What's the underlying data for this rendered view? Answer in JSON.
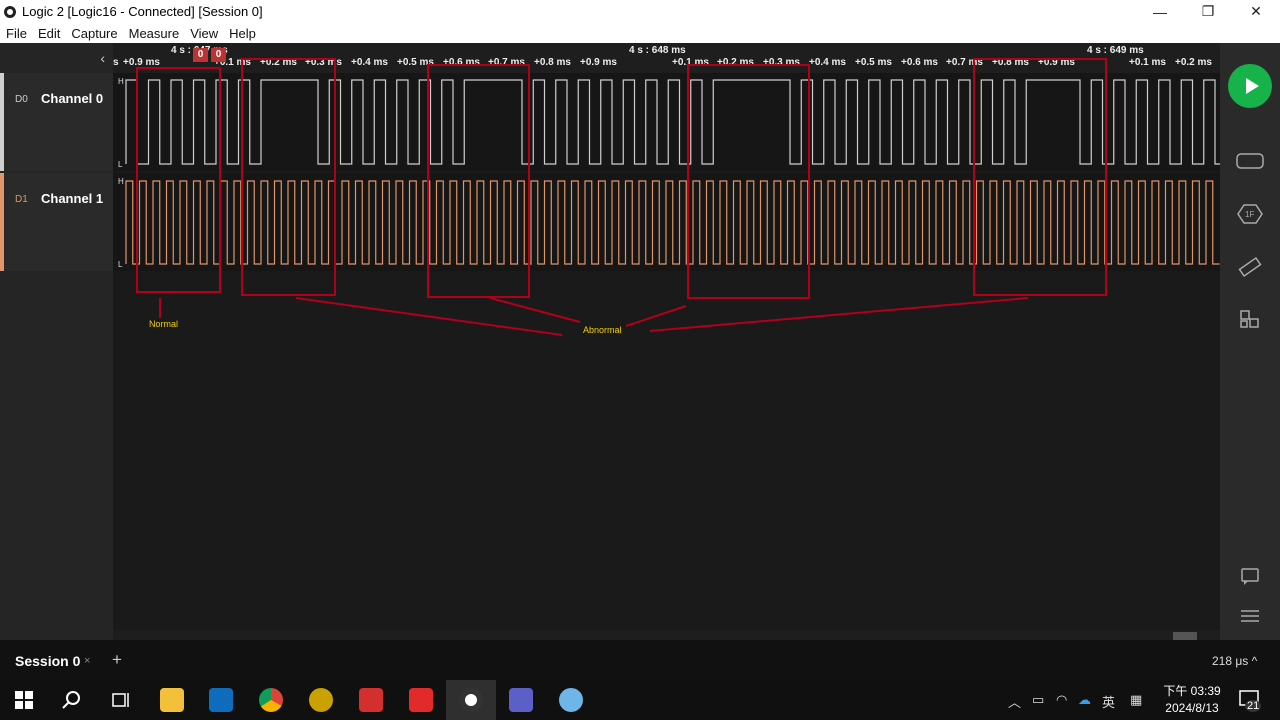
{
  "window": {
    "title": "Logic 2 [Logic16 - Connected] [Session 0]",
    "minimize": "—",
    "maximize": "❐",
    "close": "✕"
  },
  "menu": [
    "File",
    "Edit",
    "Capture",
    "Measure",
    "View",
    "Help"
  ],
  "left_panel": {
    "collapse": "‹",
    "channels": [
      {
        "tag": "D0",
        "name": "Channel 0",
        "color": "#cfcfcf"
      },
      {
        "tag": "D1",
        "name": "Channel 1",
        "color": "#e0956a"
      }
    ]
  },
  "ruler": {
    "major": [
      "4 s : 647 ms",
      "4 s : 648 ms",
      "4 s : 649 ms"
    ],
    "ticks": [
      "s",
      "+0.9 ms",
      "+0.1 ms",
      "+0.2 ms",
      "+0.3 ms",
      "+0.4 ms",
      "+0.5 ms",
      "+0.6 ms",
      "+0.7 ms",
      "+0.8 ms",
      "+0.9 ms",
      "+0.1 ms",
      "+0.2 ms",
      "+0.3 ms",
      "+0.4 ms",
      "+0.5 ms",
      "+0.6 ms",
      "+0.7 ms",
      "+0.8 ms",
      "+0.9 ms",
      "+0.1 ms",
      "+0.2 ms"
    ],
    "markers": [
      "0",
      "0"
    ]
  },
  "levels": {
    "high": "H",
    "low": "L"
  },
  "annotations": {
    "normal": "Normal",
    "abnormal": "Abnormal",
    "box_color": "#b0001a",
    "label_color": "#f0d000"
  },
  "session": {
    "tab": "Session 0",
    "close": "×",
    "add": "+",
    "timescale": "218 μs ^"
  },
  "taskbar": {
    "apps": [
      "windows-start",
      "search",
      "task-view",
      "file-explorer",
      "outlook",
      "chrome",
      "ultraedit",
      "acrobat",
      "3d-app",
      "logic2",
      "teams",
      "paint"
    ],
    "tray_input": "英",
    "clock_period": "下午 03:39",
    "clock_date": "2024/8/13",
    "notifications": "21"
  }
}
